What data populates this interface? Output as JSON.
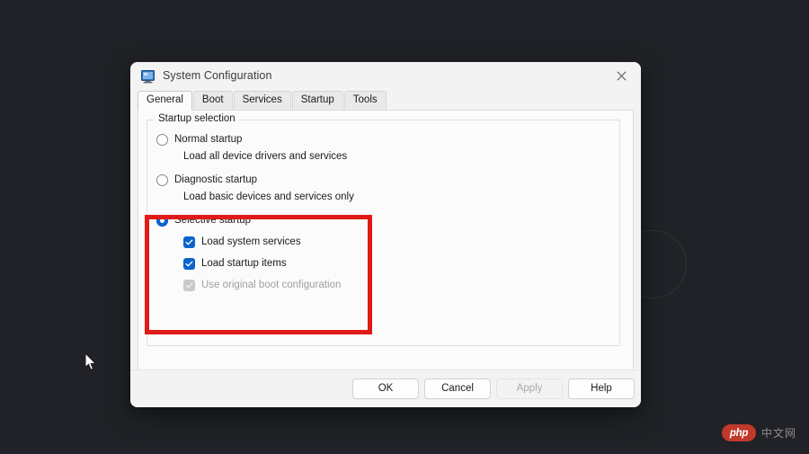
{
  "desktop": {
    "background_color": "#202227",
    "cursor": "mouse-pointer"
  },
  "dialog": {
    "title": "System Configuration",
    "title_icon": "system-configuration-icon",
    "close_label": "✕",
    "tabs": [
      {
        "label": "General",
        "active": true
      },
      {
        "label": "Boot",
        "active": false
      },
      {
        "label": "Services",
        "active": false
      },
      {
        "label": "Startup",
        "active": false
      },
      {
        "label": "Tools",
        "active": false
      }
    ],
    "groupbox": {
      "title": "Startup selection",
      "options": [
        {
          "label": "Normal startup",
          "description": "Load all device drivers and services",
          "selected": false
        },
        {
          "label": "Diagnostic startup",
          "description": "Load basic devices and services only",
          "selected": false
        },
        {
          "label": "Selective startup",
          "description": "",
          "selected": true
        }
      ],
      "checkboxes": [
        {
          "label": "Load system services",
          "checked": true,
          "disabled": false
        },
        {
          "label": "Load startup items",
          "checked": true,
          "disabled": false
        },
        {
          "label": "Use original boot configuration",
          "checked": true,
          "disabled": true
        }
      ]
    },
    "buttons": [
      {
        "label": "OK",
        "disabled": false
      },
      {
        "label": "Cancel",
        "disabled": false
      },
      {
        "label": "Apply",
        "disabled": true
      },
      {
        "label": "Help",
        "disabled": false
      }
    ]
  },
  "annotation": {
    "color": "#e01b17",
    "shape": "rectangle-highlight"
  },
  "watermark": {
    "badge": "php",
    "text": "中文网"
  }
}
